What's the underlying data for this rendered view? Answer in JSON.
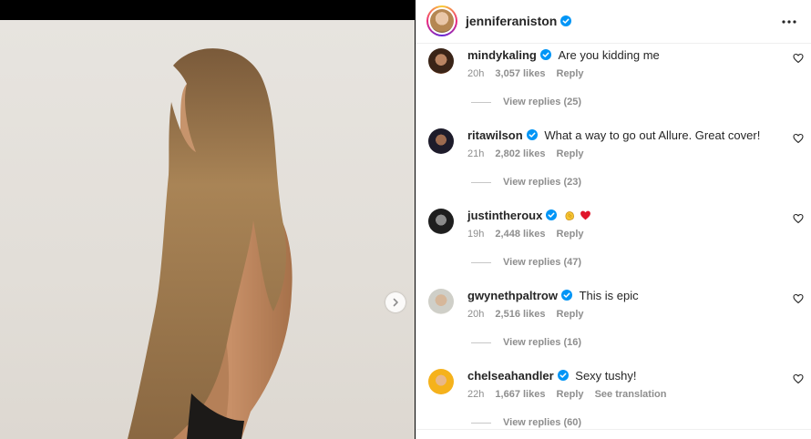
{
  "post": {
    "author": "jenniferaniston"
  },
  "icons": {
    "next": "chevron-right-icon",
    "more": "more-options-icon",
    "verified": "verified-badge-icon",
    "like": "heart-outline-icon"
  },
  "colors": {
    "verified": "#0095f6",
    "muted": "#8e8e8e",
    "text": "#262626"
  },
  "comments": [
    {
      "user": "mindykaling",
      "text": "Are you kidding me",
      "time": "20h",
      "likes": "3,057 likes",
      "reply": "Reply",
      "replies": "View replies (25)"
    },
    {
      "user": "ritawilson",
      "text": "What a way to go out Allure. Great cover!",
      "time": "21h",
      "likes": "2,802 likes",
      "reply": "Reply",
      "replies": "View replies (23)"
    },
    {
      "user": "justintheroux",
      "text": "",
      "time": "19h",
      "likes": "2,448 likes",
      "reply": "Reply",
      "replies": "View replies (47)"
    },
    {
      "user": "gwynethpaltrow",
      "text": "This is epic",
      "time": "20h",
      "likes": "2,516 likes",
      "reply": "Reply",
      "replies": "View replies (16)"
    },
    {
      "user": "chelseahandler",
      "text": "Sexy tushy!",
      "time": "22h",
      "likes": "1,667 likes",
      "reply": "Reply",
      "translate": "See translation",
      "replies": "View replies (60)"
    }
  ]
}
